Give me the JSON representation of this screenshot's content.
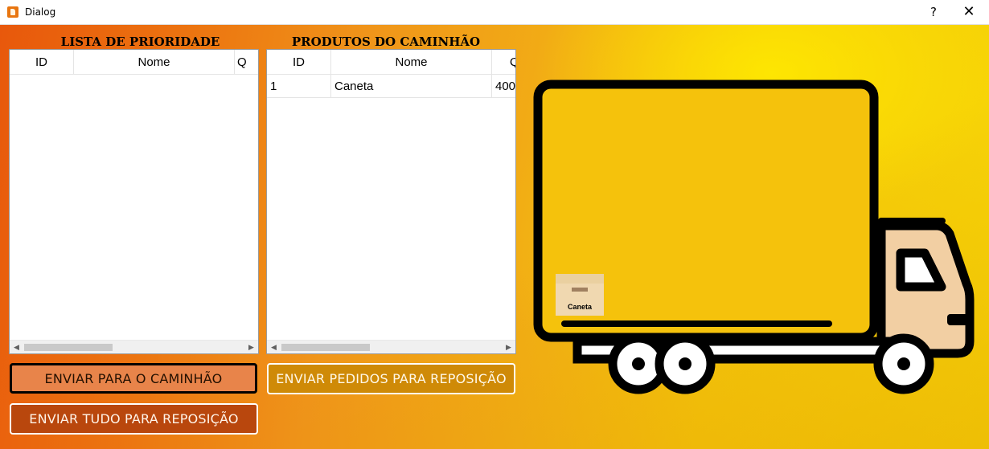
{
  "window": {
    "title": "Dialog",
    "help_label": "?",
    "close_label": "✕"
  },
  "priority_panel": {
    "title": "LISTA DE PRIORIDADE",
    "columns": [
      "ID",
      "Nome",
      "Q"
    ],
    "rows": []
  },
  "truck_panel": {
    "title": "PRODUTOS DO CAMINHÃO",
    "columns": [
      "ID",
      "Nome",
      "Q"
    ],
    "rows": [
      {
        "id": "1",
        "nome": "Caneta",
        "qtd": "400"
      }
    ]
  },
  "buttons": {
    "send_to_truck": "ENVIAR PARA O CAMINHÃO",
    "send_all_restock": "ENVIAR TUDO PARA REPOSIÇÃO",
    "send_orders_restock": "ENVIAR PEDIDOS PARA REPOSIÇÃO"
  },
  "truck": {
    "cargo_label": "Caneta",
    "icon": "truck-icon"
  },
  "colors": {
    "bg_left": "#e8580c",
    "bg_right": "#f7d606",
    "send_btn": "#e8844a",
    "send_all_btn": "#b9470d",
    "orders_btn": "#cf8a07",
    "truck_body": "#f5c20c",
    "box": "#f0d8b0"
  }
}
